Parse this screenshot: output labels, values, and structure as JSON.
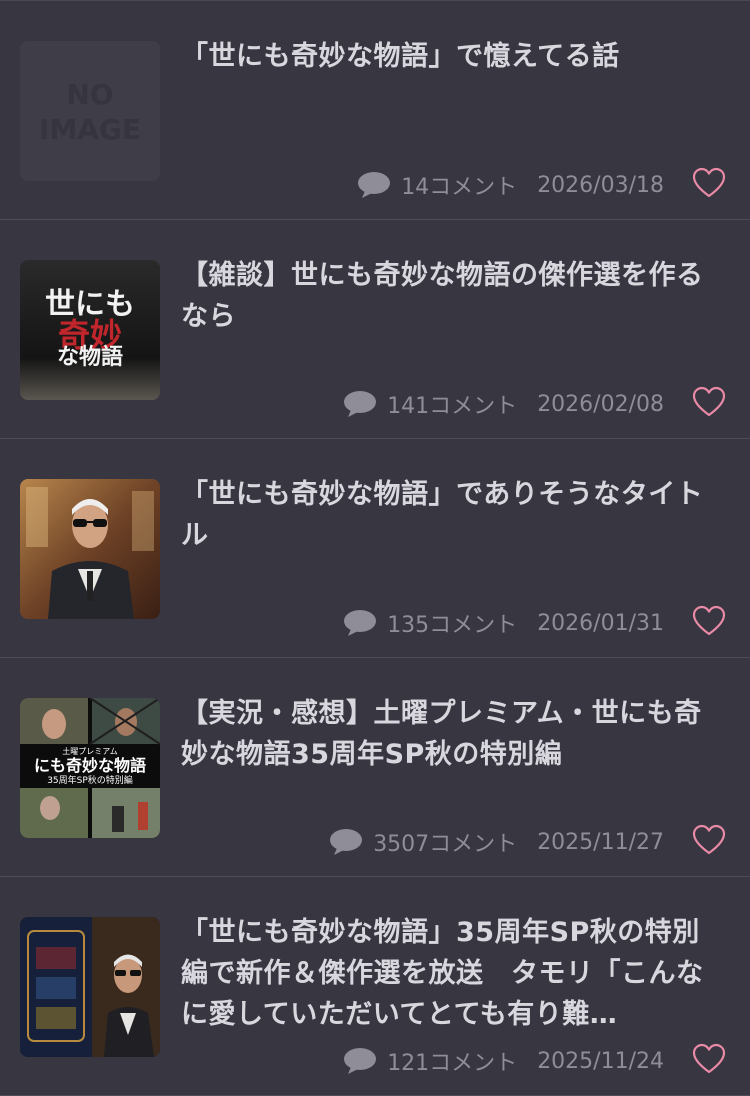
{
  "colors": {
    "background": "#383641",
    "divider": "#4d4b56",
    "title_text": "#d9d7de",
    "meta_text": "#8f8d97",
    "heart_accent": "#e98aa6"
  },
  "articles": [
    {
      "title": "「世にも奇妙な物語」で憶えてる話",
      "comments": "14コメント",
      "date": "2026/03/18",
      "thumbnail": {
        "kind": "no-image",
        "text_line1": "NO",
        "text_line2": "IMAGE"
      }
    },
    {
      "title": "【雑談】世にも奇妙な物語の傑作選を作るなら",
      "comments": "141コメント",
      "date": "2026/02/08",
      "thumbnail": {
        "kind": "logo",
        "text_line1": "世にも",
        "text_line2": "奇妙",
        "text_line3": "な物語"
      }
    },
    {
      "title": "「世にも奇妙な物語」でありそうなタイトル",
      "comments": "135コメント",
      "date": "2026/01/31",
      "thumbnail": {
        "kind": "photo-host"
      }
    },
    {
      "title": "【実況・感想】土曜プレミアム・世にも奇妙な物語35周年SP秋の特別編",
      "comments": "3507コメント",
      "date": "2025/11/27",
      "thumbnail": {
        "kind": "collage",
        "text_line1": "土曜プレミアム",
        "text_line2": "にも奇妙な物語",
        "text_line3": "35周年SP秋の特別編"
      }
    },
    {
      "title": "「世にも奇妙な物語」35周年SP秋の特別編で新作＆傑作選を放送　タモリ「こんなに愛していただいてとても有り難…",
      "comments": "121コメント",
      "date": "2025/11/24",
      "thumbnail": {
        "kind": "photo-host-logo"
      }
    }
  ]
}
